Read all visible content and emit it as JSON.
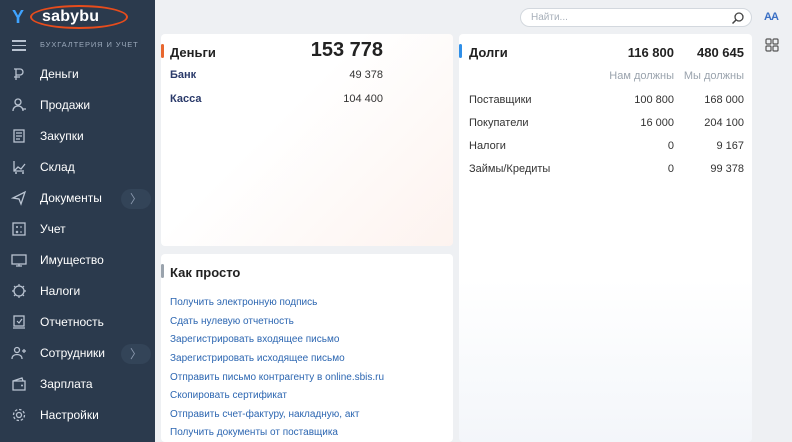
{
  "logo": {
    "text": "sabybu"
  },
  "sidebar": {
    "caption": "БУХГАЛТЕРИЯ И УЧЕТ",
    "items": [
      {
        "label": "Деньги",
        "icon": "money-icon"
      },
      {
        "label": "Продажи",
        "icon": "sales-icon"
      },
      {
        "label": "Закупки",
        "icon": "purchases-icon"
      },
      {
        "label": "Склад",
        "icon": "warehouse-icon"
      },
      {
        "label": "Документы",
        "icon": "documents-icon",
        "chevron": "〉"
      },
      {
        "label": "Учет",
        "icon": "accounting-icon"
      },
      {
        "label": "Имущество",
        "icon": "property-icon"
      },
      {
        "label": "Налоги",
        "icon": "taxes-icon"
      },
      {
        "label": "Отчетность",
        "icon": "reports-icon"
      },
      {
        "label": "Сотрудники",
        "icon": "employees-icon",
        "chevron": "〉"
      },
      {
        "label": "Зарплата",
        "icon": "salary-icon"
      },
      {
        "label": "Настройки",
        "icon": "settings-icon"
      }
    ]
  },
  "search": {
    "placeholder": "Найти..."
  },
  "topbar": {
    "font_label": "AA"
  },
  "money": {
    "title": "Деньги",
    "total": "153 778",
    "rows": [
      {
        "label": "Банк",
        "value": "49 378"
      },
      {
        "label": "Касса",
        "value": "104 400"
      }
    ],
    "accent": "#e8672f"
  },
  "debts": {
    "title": "Долги",
    "total_owed_to_us": "116 800",
    "total_we_owe": "480 645",
    "col1": "Нам должны",
    "col2": "Мы должны",
    "rows": [
      {
        "label": "Поставщики",
        "a": "100 800",
        "b": "168 000"
      },
      {
        "label": "Покупатели",
        "a": "16 000",
        "b": "204 100"
      },
      {
        "label": "Налоги",
        "a": "0",
        "b": "9 167"
      },
      {
        "label": "Займы/Кредиты",
        "a": "0",
        "b": "99 378"
      }
    ],
    "accent": "#2f8fe8"
  },
  "easy": {
    "title": "Как просто",
    "links": [
      "Получить электронную подпись",
      "Сдать нулевую отчетность",
      "Зарегистрировать входящее письмо",
      "Зарегистрировать исходящее письмо",
      "Отправить письмо контрагенту в online.sbis.ru",
      "Скопировать сертификат",
      "Отправить счет-фактуру, накладную, акт",
      "Получить документы от поставщика"
    ],
    "accent": "#9aa3ad"
  }
}
